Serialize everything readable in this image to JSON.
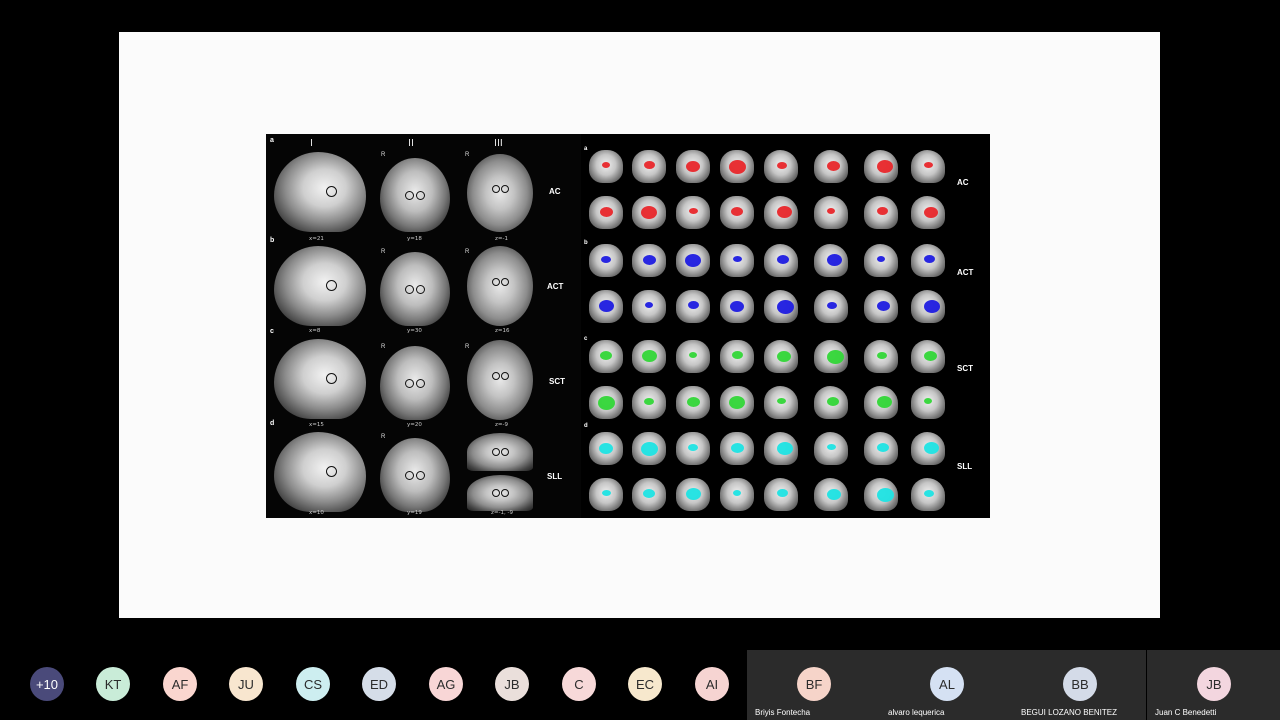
{
  "figure": {
    "column_headers": [
      "I",
      "II",
      "III"
    ],
    "row_letters": [
      "a",
      "b",
      "c",
      "d"
    ],
    "row_labels": [
      "AC",
      "ACT",
      "SCT",
      "SLL"
    ],
    "r_marker": "R",
    "coordinates": [
      [
        "x=21",
        "y=18",
        "z=-1"
      ],
      [
        "x=8",
        "y=30",
        "z=16"
      ],
      [
        "x=15",
        "y=20",
        "z=-9"
      ],
      [
        "x=10",
        "y=19",
        "z=-1, -9"
      ]
    ],
    "right_group_letters": [
      "a",
      "b",
      "c",
      "d"
    ],
    "right_group_labels": [
      "AC",
      "ACT",
      "SCT",
      "SLL"
    ],
    "overlay_colors": [
      "#e8262a",
      "#1d1be0",
      "#32d637",
      "#1ee3e3"
    ]
  },
  "participants": {
    "overflow": {
      "label": "+10",
      "color": "#4a4a7a",
      "text_color": "#ffffff"
    },
    "avatars": [
      {
        "initials": "KT",
        "color": "#c9ecd8"
      },
      {
        "initials": "AF",
        "color": "#fad6cf"
      },
      {
        "initials": "JU",
        "color": "#f8e6cf"
      },
      {
        "initials": "CS",
        "color": "#cdeef0"
      },
      {
        "initials": "ED",
        "color": "#d5dde8"
      },
      {
        "initials": "AG",
        "color": "#f8d6d6"
      },
      {
        "initials": "JB",
        "color": "#eadfdb"
      },
      {
        "initials": "C",
        "color": "#f7d9d9"
      },
      {
        "initials": "EC",
        "color": "#f7e8cd"
      },
      {
        "initials": "AI",
        "color": "#f6d4d2"
      }
    ],
    "tiles": [
      {
        "initials": "BF",
        "name": "Briyis Fontecha",
        "color": "#f6d4c9"
      },
      {
        "initials": "AL",
        "name": "alvaro lequerica",
        "color": "#d5e1f3"
      },
      {
        "initials": "BB",
        "name": "BEGUI LOZANO BENITEZ",
        "color": "#d4dbe8"
      },
      {
        "initials": "JB",
        "name": "Juan C Benedetti",
        "color": "#f3d6df"
      }
    ]
  }
}
